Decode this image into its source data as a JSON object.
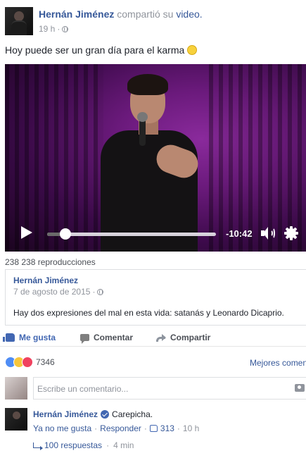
{
  "post": {
    "author": "Hernán Jiménez",
    "shared_text": "compartió su",
    "video_link": "video.",
    "time": "19 h",
    "separator": "·",
    "text": "Hoy puede ser un gran día para el karma"
  },
  "video": {
    "time_remaining": "-10:42",
    "progress": 0.11,
    "views": "238 238 reproducciones"
  },
  "attachment": {
    "author": "Hernán Jiménez",
    "date": "7 de agosto de 2015",
    "separator": "·",
    "text": "Hay dos expresiones del mal en esta vida: satanás y Leonardo Dicaprio."
  },
  "actions": {
    "like": "Me gusta",
    "comment": "Comentar",
    "share": "Compartir"
  },
  "reactions": {
    "count": "7346",
    "best_comments": "Mejores comentarios"
  },
  "comment_box": {
    "placeholder": "Escribe un comentario..."
  },
  "comment": {
    "author": "Hernán Jiménez",
    "text": "Carepicha.",
    "unlike": "Ya no me gusta",
    "reply": "Responder",
    "likes": "313",
    "time": "10 h",
    "dot": "·",
    "replies": "100 respuestas",
    "replies_time": "4 min"
  },
  "colors": {
    "link": "#365899",
    "like_blue": "#4267b2",
    "muted": "#90949c"
  }
}
